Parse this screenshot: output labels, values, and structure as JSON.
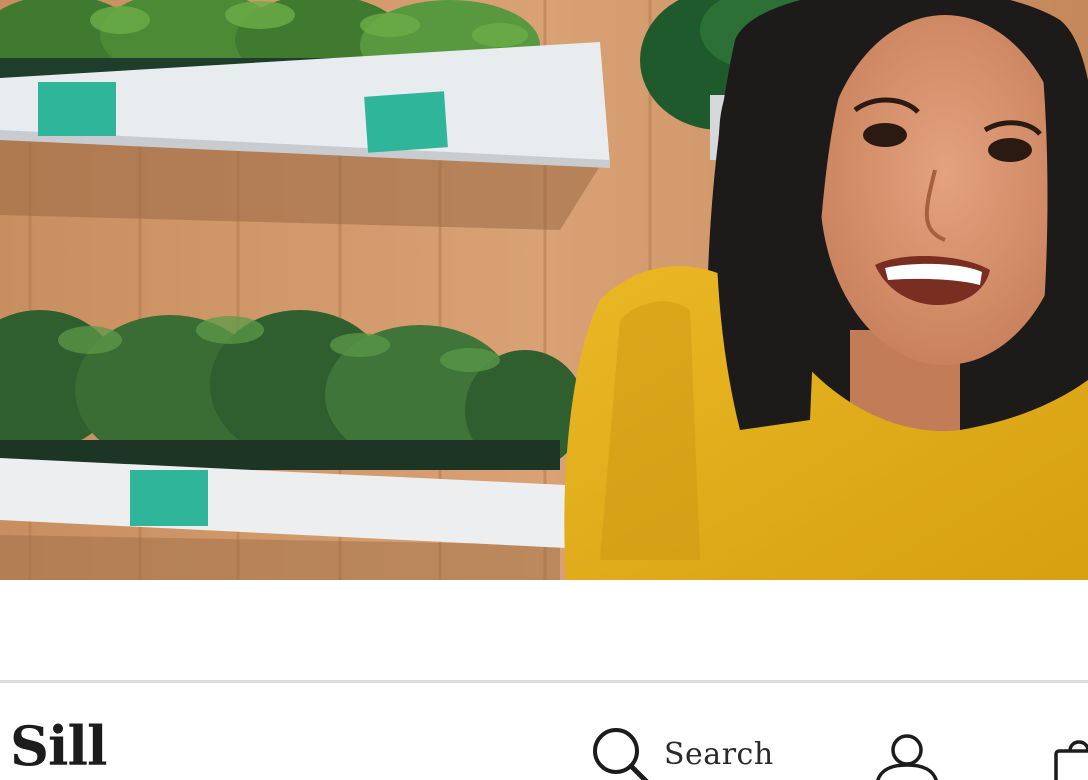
{
  "header": {
    "logo_text": "Sill",
    "search_label": "Search",
    "icons": {
      "search": "search-icon",
      "account": "user-icon",
      "cart": "cart-icon"
    }
  },
  "hero": {
    "image_subject": "hero-photo"
  },
  "colors": {
    "shelf_tag": "#2fb59a",
    "shirt": "#e5b01c",
    "header_border": "#dcdcdc",
    "text": "#1c1c1c"
  }
}
